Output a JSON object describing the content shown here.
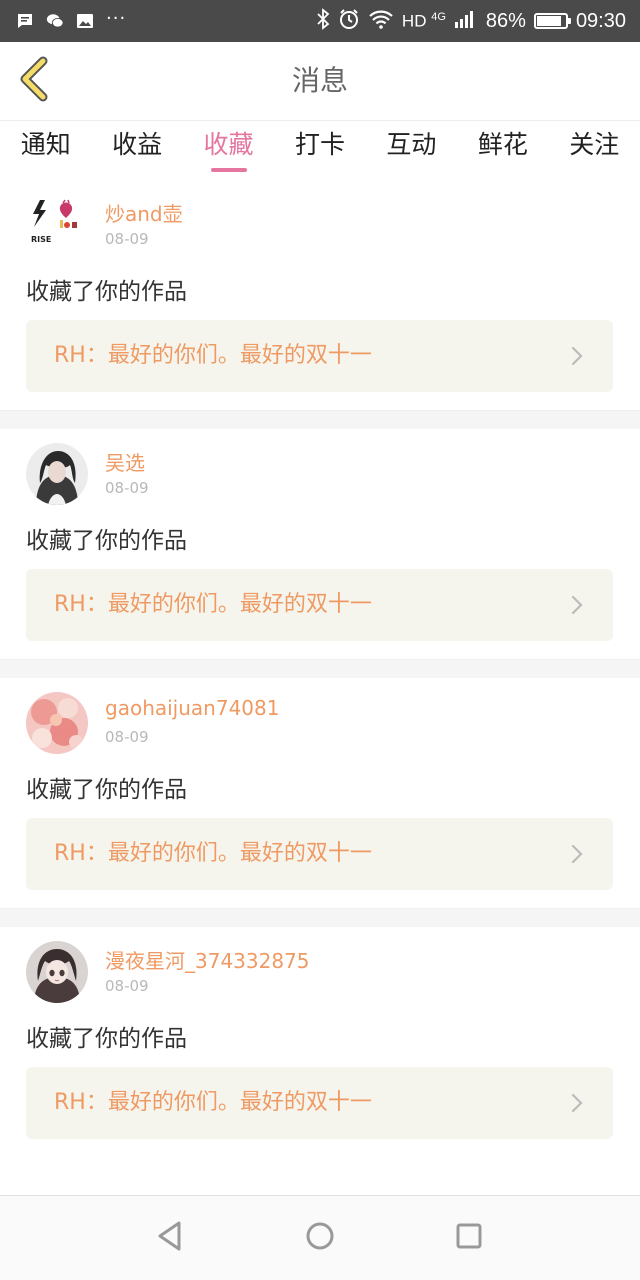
{
  "status_bar": {
    "network": "HD",
    "network_gen": "4G",
    "battery_text": "86%",
    "battery_level": 0.86,
    "time": "09:30",
    "more": "···"
  },
  "header": {
    "title": "消息"
  },
  "tabs": [
    {
      "label": "通知"
    },
    {
      "label": "收益"
    },
    {
      "label": "收藏",
      "active": true
    },
    {
      "label": "打卡"
    },
    {
      "label": "互动"
    },
    {
      "label": "鲜花"
    },
    {
      "label": "关注"
    }
  ],
  "messages": [
    {
      "user": "炒and壶",
      "date": "08-09",
      "action": "收藏了你的作品",
      "work_title": "RH：最好的你们。最好的双十一",
      "avatar_text": "RISE"
    },
    {
      "user": "吴选",
      "date": "08-09",
      "action": "收藏了你的作品",
      "work_title": "RH：最好的你们。最好的双十一"
    },
    {
      "user": "gaohaijuan74081",
      "date": "08-09",
      "action": "收藏了你的作品",
      "work_title": "RH：最好的你们。最好的双十一"
    },
    {
      "user": "漫夜星河_374332875",
      "date": "08-09",
      "action": "收藏了你的作品",
      "work_title": "RH：最好的你们。最好的双十一"
    }
  ],
  "colors": {
    "accent": "#e476a0",
    "username": "#ef9a63",
    "status_bar_bg": "#4a4a4a",
    "card_bg": "#f5f5ee"
  },
  "icons": {
    "back": "chevron-left-icon",
    "item_arrow": "chevron-right-icon",
    "nav_back": "triangle-back-icon",
    "nav_home": "circle-home-icon",
    "nav_recent": "square-recent-icon"
  }
}
